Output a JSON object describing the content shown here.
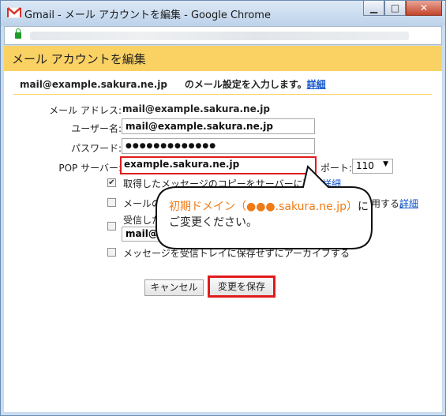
{
  "window": {
    "title": "Gmail - メール アカウントを編集 - Google Chrome",
    "minimize_glyph": "▁",
    "maximize_glyph": "□",
    "close_glyph": "✕"
  },
  "banner": {
    "title": "メール アカウントを編集"
  },
  "intro": {
    "email": "mail@example.sakura.ne.jp",
    "text": "のメール設定を入力します。",
    "link": "詳細"
  },
  "form": {
    "email_label": "メール アドレス:",
    "email_value": "mail@example.sakura.ne.jp",
    "username_label": "ユーザー名:",
    "username_value": "mail@example.sakura.ne.jp",
    "password_label": "パスワード:",
    "password_value": "●●●●●●●●●●●●●",
    "pop_label": "POP サーバー:",
    "pop_value": "example.sakura.ne.jp",
    "port_label": "ポート:",
    "port_value": "110"
  },
  "options": {
    "opt1_text": "取得したメッセージのコピーをサーバーに残",
    "opt1_link": "詳細",
    "opt1_checked": true,
    "opt2_text": "メールの",
    "opt2_suffix": "用する。",
    "opt2_link": "詳細",
    "opt3_text": "受信した",
    "opt3_select": "mail@",
    "opt4_text": "メッセージを受信トレイに保存せずにアーカイブする"
  },
  "buttons": {
    "cancel": "キャンセル",
    "save": "変更を保存"
  },
  "callout": {
    "line1_orange": "初期ドメイン（●●●.sakura.ne.jp）",
    "line1_black": "に",
    "line2": "ご変更ください。"
  },
  "colors": {
    "banner": "#fad163",
    "highlight": "#e01b1b",
    "accent": "#f07a15",
    "link": "#1155cc"
  }
}
